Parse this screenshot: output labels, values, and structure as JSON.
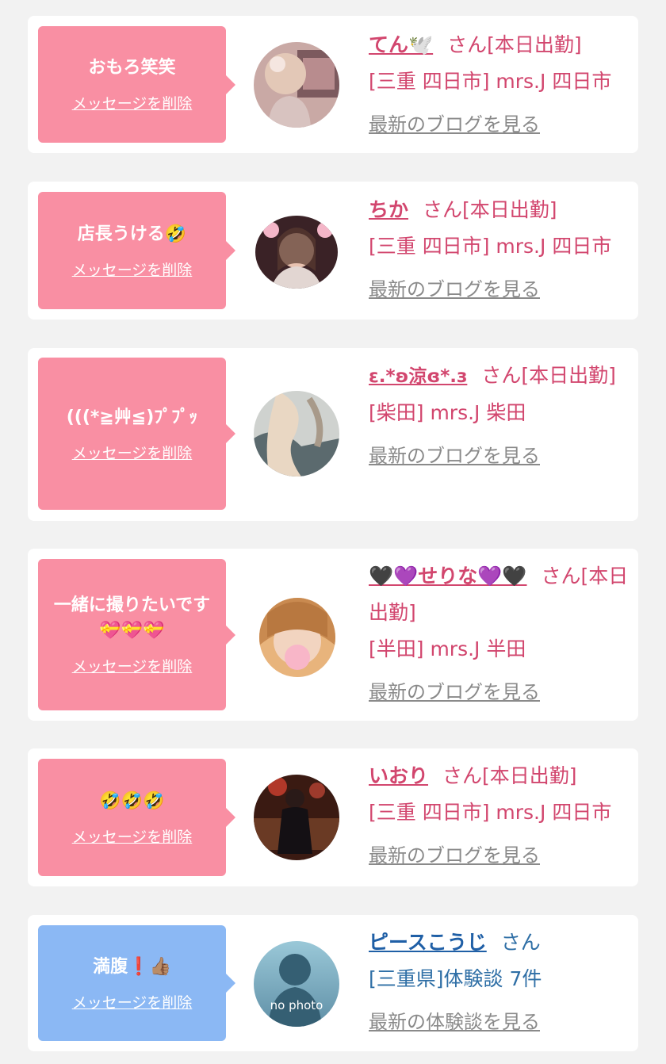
{
  "cards": [
    {
      "message": "おもろ笑笑",
      "delete_label": "メッセージを削除",
      "name": "てん🕊️",
      "suffix": "さん[本日出勤]",
      "location": "[三重 四日市] mrs.J 四日市",
      "link": "最新のブログを見る",
      "color": "#f98fa3"
    },
    {
      "message": "店長うける🤣",
      "delete_label": "メッセージを削除",
      "name": "ちか",
      "suffix": "さん[本日出勤]",
      "location": "[三重 四日市] mrs.J 四日市",
      "link": "最新のブログを見る",
      "color": "#f98fa3"
    },
    {
      "message": "(((*≧艸≦)ﾌﾟﾌﾟｯ",
      "delete_label": "メッセージを削除",
      "name": "ε.*ʚ涼ɞ*.з",
      "suffix": "さん[本日出勤]",
      "location": "[柴田] mrs.J 柴田",
      "link": "最新のブログを見る",
      "color": "#f98fa3"
    },
    {
      "message": "一緒に撮りたいです💝💝💝",
      "delete_label": "メッセージを削除",
      "name": "🖤💜せりな💜🖤",
      "suffix": "さん[本日出勤]",
      "location": "[半田] mrs.J 半田",
      "link": "最新のブログを見る",
      "color": "#f98fa3"
    },
    {
      "message": "🤣🤣🤣",
      "delete_label": "メッセージを削除",
      "name": "いおり",
      "suffix": "さん[本日出勤]",
      "location": "[三重 四日市] mrs.J 四日市",
      "link": "最新のブログを見る",
      "color": "#f98fa3"
    },
    {
      "message": "満腹❗️👍🏽",
      "delete_label": "メッセージを削除",
      "name": "ピースこうじ",
      "suffix": "さん",
      "location": "[三重県]体験談 7件",
      "link": "最新の体験談を見る",
      "color": "#8bb8f4",
      "avatar_text": "no photo"
    }
  ]
}
